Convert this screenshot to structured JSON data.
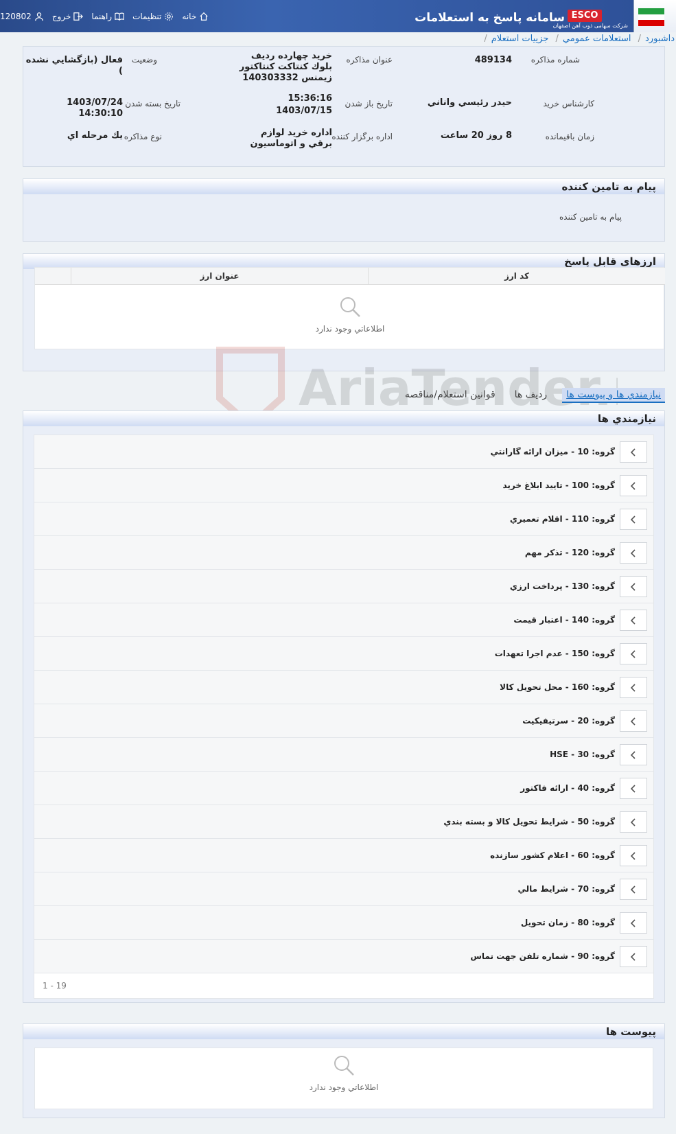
{
  "header": {
    "app_title": "سامانه پاسخ به استعلامات",
    "esco": "ESCO",
    "esco_sub": "شرکت سهامی ذوب آهن اصفهان",
    "nav": {
      "home": "خانه",
      "settings": "تنظيمات",
      "help": "راهنما",
      "logout": "خروج",
      "user_id": "120802"
    }
  },
  "breadcrumb": [
    "داشبورد",
    "استعلامات عمومي",
    "جزييات استعلام"
  ],
  "info": {
    "negotiation_number_label": "شماره مذاکره",
    "negotiation_number": "489134",
    "negotiation_title_label": "عنوان مذاکره",
    "negotiation_title": "خريد چهارده رديف بلوك كنتاكت كنتاكتور زيمنس 140303332",
    "status_label": "وضعيت",
    "status": "فعال (بازگشايي نشده )",
    "buyer_expert_label": "کارشناس خريد",
    "buyer_expert": "حيدر رئيسي واناني",
    "open_date_label": "تاريخ باز شدن",
    "open_time": "15:36:16",
    "open_date": "1403/07/15",
    "close_date_label": "تاريخ بسته شدن",
    "close_date": "1403/07/24 14:30:10",
    "remaining_label": "زمان باقيمانده",
    "remaining": "8 روز 20 ساعت",
    "organizer_label": "اداره برگزار کننده",
    "organizer": "اداره خريد لوازم برقي و اتوماسيون",
    "negotiation_type_label": "نوع مذاکره",
    "negotiation_type": "يك مرحله اي"
  },
  "supplier_message": {
    "title": "پيام به تامين کننده",
    "text": "پيام به تامين کننده"
  },
  "currencies": {
    "title": "ارزهای قابل پاسخ",
    "col_code": "کد ارز",
    "col_title": "عنوان ارز",
    "empty": "اطلاعاتي وجود ندارد"
  },
  "tabs": [
    "نيازمندي ها و پيوست ها",
    "رديف ها",
    "قوانين استعلام/مناقصه"
  ],
  "requirements": {
    "title": "نيازمندي ها",
    "groups": [
      "گروه: 10 - ميزان ارائه گارانتي",
      "گروه: 100 - تاييد ابلاغ خريد",
      "گروه: 110 - اقلام تعميري",
      "گروه: 120 - تذكر مهم",
      "گروه: 130 - پرداخت ارزي",
      "گروه: 140 - اعتبار قيمت",
      "گروه: 150 - عدم اجرا تعهدات",
      "گروه: 160 - محل تحويل كالا",
      "گروه: 20 - سرتيفيكيت",
      "گروه: 30 - HSE",
      "گروه: 40 - ارائه فاكتور",
      "گروه: 50 - شرايط تحويل كالا و بسته بندي",
      "گروه: 60 - اعلام كشور سازنده",
      "گروه: 70 - شرايط مالي",
      "گروه: 80 - زمان تحويل",
      "گروه: 90 - شماره تلفن جهت تماس"
    ],
    "pager": "1 - 19"
  },
  "attachments": {
    "title": "پيوست ها",
    "empty": "اطلاعاتي وجود ندارد"
  },
  "watermark": "AriaTender.neT"
}
